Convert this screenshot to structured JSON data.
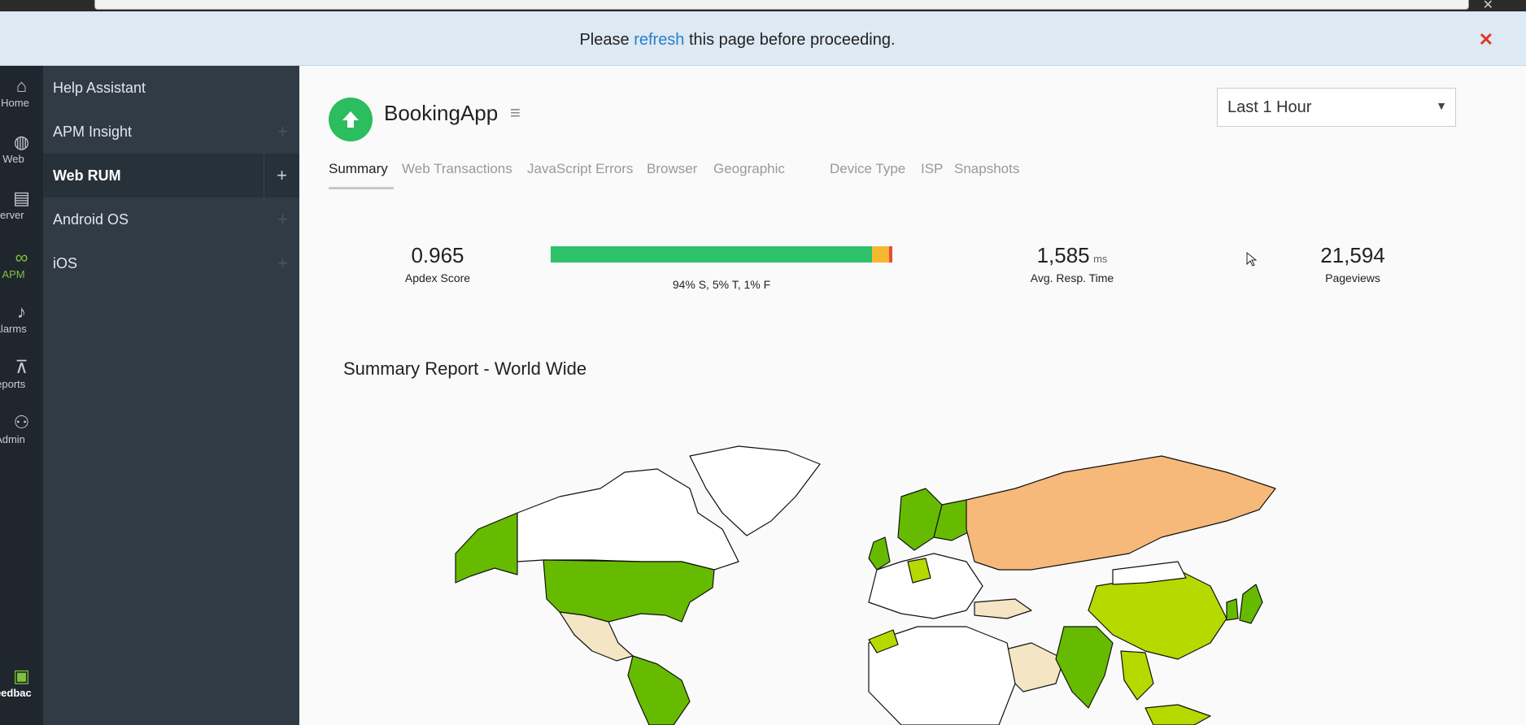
{
  "notice": {
    "before": "Please ",
    "link": "refresh",
    "after": " this page before proceeding.",
    "close_icon": "close-icon"
  },
  "rail": [
    {
      "label": "Home",
      "icon": "home-icon",
      "glyph": "⌂"
    },
    {
      "label": "Web",
      "icon": "globe-icon",
      "glyph": "◍"
    },
    {
      "label": "Server",
      "icon": "server-icon",
      "glyph": "▤"
    },
    {
      "label": "APM",
      "icon": "binoculars-icon",
      "glyph": "∞"
    },
    {
      "label": "Alarms",
      "icon": "bell-icon",
      "glyph": "♪"
    },
    {
      "label": "Reports",
      "icon": "presentation-icon",
      "glyph": "⊼"
    },
    {
      "label": "Admin",
      "icon": "admin-icon",
      "glyph": "⚇"
    },
    {
      "label": "Feedback",
      "icon": "chat-icon",
      "glyph": "▣"
    }
  ],
  "sidebar": {
    "items": [
      {
        "label": "Help Assistant",
        "plus": ""
      },
      {
        "label": "APM Insight",
        "plus": "+"
      },
      {
        "label": "Web RUM",
        "plus": "+"
      },
      {
        "label": "Android OS",
        "plus": "+"
      },
      {
        "label": "iOS",
        "plus": "+"
      }
    ]
  },
  "app": {
    "name": "BookingApp",
    "status_icon": "arrow-up-icon"
  },
  "time_select": {
    "value": "Last 1 Hour"
  },
  "tabs": [
    "Summary",
    "Web Transactions",
    "JavaScript Errors",
    "Browser",
    "Geographic",
    "Device Type",
    "ISP",
    "Snapshots"
  ],
  "metrics": {
    "apdex": {
      "value": "0.965",
      "caption": "Apdex Score"
    },
    "apdex_breakdown": {
      "caption": "94% S, 5% T, 1% F",
      "satisfied": 94,
      "tolerating": 5,
      "frustrated": 1
    },
    "resp_time": {
      "value": "1,585",
      "unit": "ms",
      "caption": "Avg. Resp. Time"
    },
    "pageviews": {
      "value": "21,594",
      "caption": "Pageviews"
    }
  },
  "summary": {
    "title": "Summary Report - World Wide"
  },
  "colors": {
    "satisfied": "#2dc26b",
    "tolerating": "#f5b82e",
    "frustrated": "#e84c3d",
    "map_dark_green": "#66bb00",
    "map_light_green": "#b6d900",
    "map_orange": "#f7b979",
    "map_cream": "#f4e6c4"
  }
}
